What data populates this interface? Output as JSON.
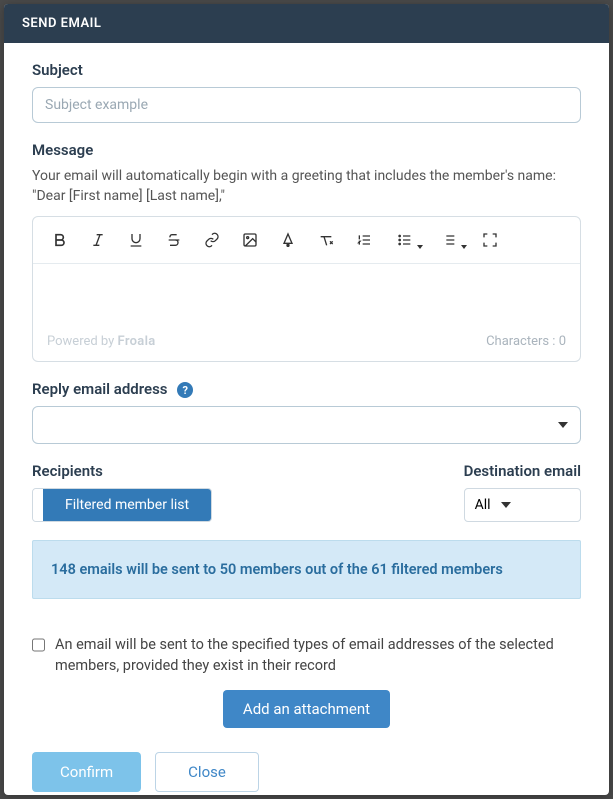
{
  "header": {
    "title": "SEND EMAIL"
  },
  "subject": {
    "label": "Subject",
    "placeholder": "Subject example",
    "value": ""
  },
  "message": {
    "label": "Message",
    "helper": "Your email will automatically begin with a greeting that includes the member's name: \"Dear [First name] [Last name],\"",
    "powered_by": "Powered by",
    "froala": "Froala",
    "characters_label": "Characters :",
    "characters_count": "0"
  },
  "toolbar": {
    "bold": "Bold",
    "italic": "Italic",
    "underline": "Underline",
    "strike": "Strikethrough",
    "link": "Insert Link",
    "image": "Insert Image",
    "color": "Text Color",
    "clear": "Clear Formatting",
    "ol": "Ordered List",
    "ul": "Unordered List",
    "para": "Paragraph Format",
    "fullscreen": "Fullscreen"
  },
  "reply": {
    "label": "Reply email address",
    "value": ""
  },
  "recipients": {
    "label": "Recipients",
    "button": "Filtered member list"
  },
  "destination": {
    "label": "Destination email",
    "selected": "All"
  },
  "banner": "148 emails will be sent to 50 members out of the 61 filtered members",
  "consent": {
    "text": "An email will be sent to the specified types of email addresses of the selected members, provided they exist in their record"
  },
  "buttons": {
    "attach": "Add an attachment",
    "confirm": "Confirm",
    "close": "Close"
  }
}
